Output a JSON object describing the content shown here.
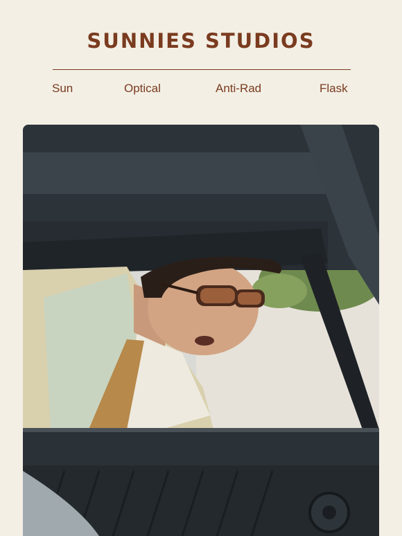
{
  "brand": {
    "name": "SUNNIES STUDIOS",
    "color": "#7a3b1f"
  },
  "nav": {
    "items": [
      {
        "label": "Sun"
      },
      {
        "label": "Optical"
      },
      {
        "label": "Anti-Rad"
      },
      {
        "label": "Flask"
      }
    ]
  },
  "hero": {
    "subject": "man in sunglasses leaning into car window",
    "background": "#f3efe5"
  }
}
